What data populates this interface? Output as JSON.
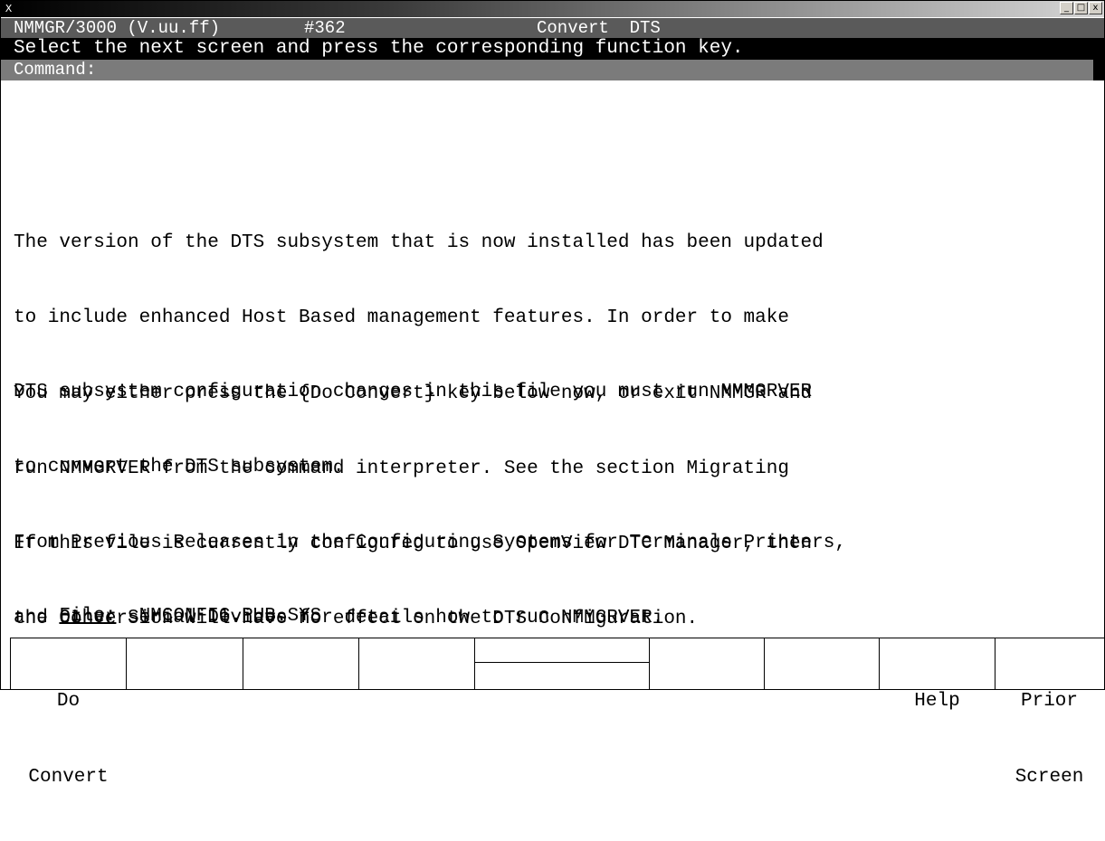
{
  "window": {
    "icon_label": "X",
    "buttons": [
      "_",
      "□",
      "x"
    ]
  },
  "header": {
    "program": "NMMGR/3000 (V.uu.ff)",
    "screen_no": "#362",
    "screen_title": "Convert  DTS",
    "instruction": "Select the next screen and press the corresponding function key.",
    "command_label": "Command:"
  },
  "body": {
    "paragraph1": [
      "The version of the DTS subsystem that is now installed has been updated",
      "to include enhanced Host Based management features. In order to make",
      "DTS subsystem configuration changes in this file you must run NMMGRVER",
      "to convert the DTS subsystem."
    ],
    "paragraph2": [
      "You may either press the {Do Convert} key below now, or exit NMMGR and",
      "run NMMGRVER from the command interpreter. See the section Migrating",
      "From Previous Releases in the Configuring Systems for Terminals Printers,",
      "and Other Serial Devices for details how to run NMMGRVER."
    ],
    "paragraph3": [
      "If this file is currently configured to use OpenView DTC Manager, then",
      "the conversion will have no effect on the DTS Configuration."
    ]
  },
  "file": {
    "label": "File:",
    "value": "NMCONFIG.PUB.SYS"
  },
  "function_keys": [
    {
      "line1": "Do",
      "line2": "Convert"
    },
    {
      "line1": "",
      "line2": ""
    },
    {
      "line1": "",
      "line2": ""
    },
    {
      "line1": "",
      "line2": ""
    },
    {
      "line1": "",
      "line2": ""
    },
    {
      "line1": "",
      "line2": ""
    },
    {
      "line1": "",
      "line2": ""
    },
    {
      "line1": "Help",
      "line2": ""
    },
    {
      "line1": "Prior",
      "line2": "Screen"
    }
  ]
}
